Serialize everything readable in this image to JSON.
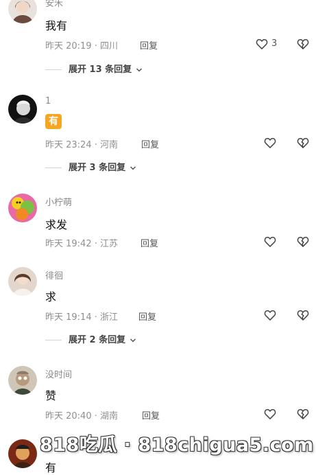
{
  "comments": [
    {
      "user": "安禾",
      "text": "我有",
      "time_location": "昨天 20:19 · 四川",
      "reply_label": "回复",
      "like_count": "3",
      "expand_label": "展开 13 条回复"
    },
    {
      "user": "1",
      "text": "有",
      "time_location": "昨天 23:24 · 河南",
      "reply_label": "回复",
      "expand_label": "展开 3 条回复"
    },
    {
      "user": "小柠萌",
      "text": "求发",
      "time_location": "昨天 19:42 · 江苏",
      "reply_label": "回复"
    },
    {
      "user": "徘徊",
      "text": "求",
      "time_location": "昨天 19:14 · 浙江",
      "reply_label": "回复",
      "expand_label": "展开 2 条回复"
    },
    {
      "user": "没时间",
      "text": "赞",
      "time_location": "昨天 20:40 · 湖南",
      "reply_label": "回复"
    },
    {
      "user": "",
      "text": "有"
    }
  ],
  "watermark": "818吃瓜 · 818chigua5.com",
  "icons": {
    "like": "heart-outline-icon",
    "dislike": "broken-heart-icon",
    "expand": "chevron-down-icon"
  },
  "colors": {
    "emoji_box": "#f6a623",
    "meta": "#8f8f8f"
  }
}
